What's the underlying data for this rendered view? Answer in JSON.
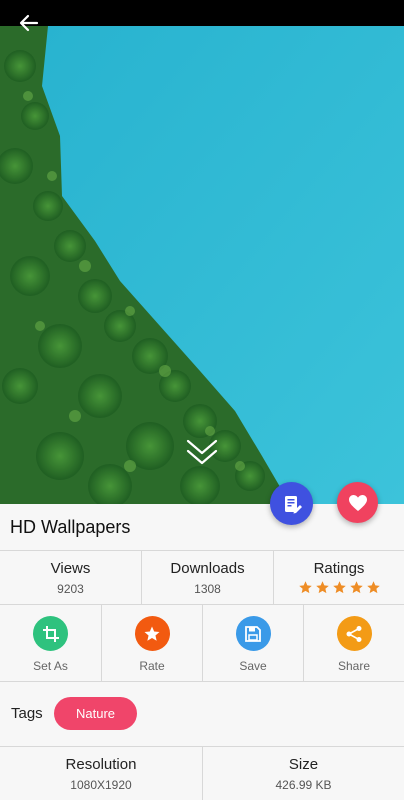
{
  "header": {
    "back_icon": "arrow-left-icon"
  },
  "hero": {
    "scroll_icon": "double-chevron-down-icon",
    "water_color": "#2bb7d2",
    "forest_color": "#2f7a2a"
  },
  "fabs": {
    "editor_icon": "photo-editor-icon",
    "editor_color": "#3f51e0",
    "favorite_icon": "heart-icon",
    "favorite_color": "#f0425f"
  },
  "title": "HD Wallpapers",
  "stats": {
    "views_label": "Views",
    "views_value": "9203",
    "downloads_label": "Downloads",
    "downloads_value": "1308",
    "ratings_label": "Ratings",
    "rating_stars": 5,
    "star_color": "#ee8d26"
  },
  "actions": [
    {
      "label": "Set As",
      "icon": "crop-icon",
      "color": "#2ec27e"
    },
    {
      "label": "Rate",
      "icon": "star-icon",
      "color": "#f25a10"
    },
    {
      "label": "Save",
      "icon": "floppy-disk-icon",
      "color": "#3a9ae8"
    },
    {
      "label": "Share",
      "icon": "share-icon",
      "color": "#f39b16"
    }
  ],
  "tags": {
    "label": "Tags",
    "items": [
      "Nature"
    ],
    "chip_color": "#f0456a"
  },
  "info": {
    "resolution_label": "Resolution",
    "resolution_value": "1080X1920",
    "size_label": "Size",
    "size_value": "426.99 KB"
  }
}
